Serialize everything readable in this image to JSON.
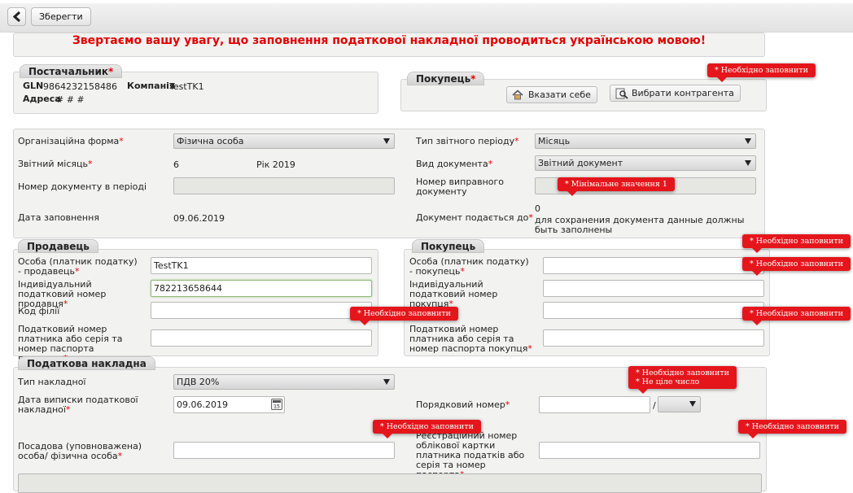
{
  "toolbar": {
    "save_label": "Зберегти"
  },
  "notice": "Звертаємо вашу увагу, що заповнення податкової накладної проводиться українською мовою!",
  "supplier": {
    "title": "Постачальник",
    "gln_label": "GLN",
    "gln": "9864232158486",
    "company_label": "Компанія",
    "company": "TestTK1",
    "address_label": "Адреса",
    "address": "# # #"
  },
  "buyer_top": {
    "title": "Покупець",
    "self_button": "Вказати себе",
    "choose_button": "Вибрати контрагента"
  },
  "form": {
    "org_form_label": "Організаційна форма",
    "org_form_value": "Фізична особа",
    "period_type_label": "Тип звітного періоду",
    "period_type_value": "Місяць",
    "month_label": "Звітний місяць",
    "month_value": "6",
    "year_text": "Рік 2019",
    "doc_type_label": "Вид документа",
    "doc_type_value": "Звітний документ",
    "doc_num_label": "Номер документу в періоді",
    "fix_num_label": "Номер виправного документу",
    "fill_date_label": "Дата заповнення",
    "fill_date_value": "09.06.2019",
    "submit_to_label": "Документ подається до",
    "submit_to_value": "0",
    "submit_to_note": "для сохранения документа данные должны быть заполнены"
  },
  "seller": {
    "title": "Продавець",
    "person_label": "Особа (платник податку) - продавець",
    "person_value": "TestTK1",
    "ipn_label": "Індивідуальний податковий номер продавця",
    "ipn_value": "782213658644",
    "branch_label": "Код філії",
    "taxnum_label": "Податковий номер платника або серія та номер паспорта продавця"
  },
  "buyer": {
    "title": "Покупець",
    "person_label": "Особа (платник податку) - покупець",
    "ipn_label": "Індивідуальний податковий номер покупця",
    "taxnum_label": "Податковий номер платника або серія та номер паспорта покупця"
  },
  "invoice": {
    "title": "Податкова накладна",
    "type_label": "Тип накладної",
    "type_value": "ПДВ 20%",
    "date_label": "Дата виписки податкової накладної",
    "date_value": "09.06.2019",
    "order_label": "Порядковий номер",
    "order_sep": "/",
    "official_label": "Посадова (уповноважена) особа/ фізична особа",
    "reg_label": "Реєстраційний номер облікової картки платника податків або серія та номер паспорта"
  },
  "tooltips": {
    "required": "* Необхідно заповнити",
    "min_value": "* Мінімальне значення 1",
    "not_integer": "* Не ціле число"
  },
  "required_mark": "*",
  "colors": {
    "required": "#e00000",
    "tooltip_bg": "#e4161b",
    "notice": "#e00000"
  }
}
